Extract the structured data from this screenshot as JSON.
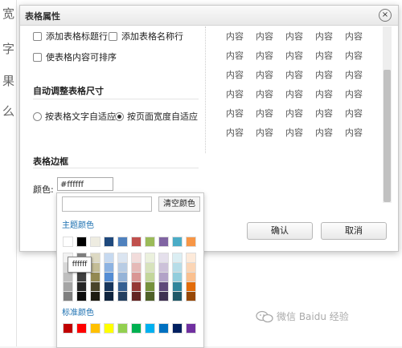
{
  "dialog": {
    "title": "表格属性",
    "close_glyph": "×",
    "options": {
      "add_header_row": "添加表格标题行",
      "add_name_row": "添加表格名称行",
      "sortable": "使表格内容可排序"
    },
    "auto_size_section": "自动调整表格尺寸",
    "radio_text_fit": "按表格文字自适应",
    "radio_page_fit": "按页面宽度自适应",
    "border_section": "表格边框",
    "color_label": "颜色:",
    "color_value": "#ffffff",
    "confirm": "确认",
    "cancel": "取消"
  },
  "preview": {
    "cell_text": "内容",
    "rows": [
      [
        "内容",
        "内容",
        "内容",
        "内容",
        "内容"
      ],
      [
        "内容",
        "内容",
        "内容",
        "内容",
        "内容"
      ],
      [
        "内容",
        "内容",
        "内容",
        "内容",
        "内容"
      ],
      [
        "内容",
        "内容",
        "内容",
        "内容",
        "内容"
      ],
      [
        "内容",
        "内容",
        "内容",
        "内容",
        "内容"
      ],
      [
        "内容",
        "内容",
        "内容",
        "内容",
        "内容"
      ]
    ]
  },
  "background_chars": [
    "宽",
    "字",
    "果",
    "么"
  ],
  "picker": {
    "clear_label": "清空颜色",
    "theme_label": "主题颜色",
    "standard_label": "标准颜色",
    "tooltip": "ffffff",
    "theme_row": [
      "#ffffff",
      "#000000",
      "#eeece1",
      "#1f497d",
      "#4f81bd",
      "#c0504d",
      "#9bbb59",
      "#8064a2",
      "#4bacc6",
      "#f79646"
    ],
    "theme_shades": [
      [
        "#f2f2f2",
        "#7f7f7f",
        "#ddd9c3",
        "#c6d9f0",
        "#dbe5f1",
        "#f2dcdb",
        "#ebf1dd",
        "#e5e0ec",
        "#dbeef3",
        "#fdeada"
      ],
      [
        "#d8d8d8",
        "#595959",
        "#c4bd97",
        "#8db3e2",
        "#b8cce4",
        "#e5b9b7",
        "#d7e3bc",
        "#ccc1d9",
        "#b7dde8",
        "#fbd5b5"
      ],
      [
        "#bfbfbf",
        "#3f3f3f",
        "#938953",
        "#548dd4",
        "#95b3d7",
        "#d99694",
        "#c3d69b",
        "#b2a2c7",
        "#92cddc",
        "#fac08f"
      ],
      [
        "#a5a5a5",
        "#262626",
        "#494429",
        "#17365d",
        "#366092",
        "#953734",
        "#76923c",
        "#5f497a",
        "#31859b",
        "#e36c09"
      ],
      [
        "#7f7f7f",
        "#0c0c0c",
        "#1d1b10",
        "#0f243e",
        "#244061",
        "#632423",
        "#4f6128",
        "#3f3151",
        "#205867",
        "#974806"
      ]
    ],
    "standard_row": [
      "#c00000",
      "#ff0000",
      "#ffc000",
      "#ffff00",
      "#92d050",
      "#00b050",
      "#00b0f0",
      "#0070c0",
      "#002060",
      "#7030a0"
    ]
  },
  "watermark": {
    "text": "微信  Baidu 经验",
    "icon": "wechat-icon"
  }
}
